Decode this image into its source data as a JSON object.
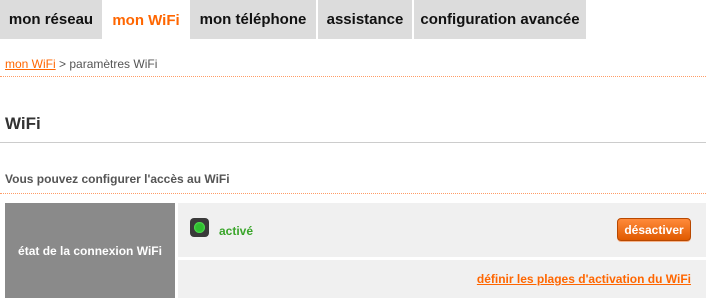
{
  "nav": {
    "tabs": [
      {
        "label": "mon réseau",
        "active": false
      },
      {
        "label": "mon WiFi",
        "active": true
      },
      {
        "label": "mon téléphone",
        "active": false
      },
      {
        "label": "assistance",
        "active": false
      },
      {
        "label": "configuration avancée",
        "active": false
      }
    ]
  },
  "breadcrumb": {
    "link": "mon WiFi",
    "separator": " > ",
    "current": "paramètres WiFi"
  },
  "page": {
    "title": "WiFi",
    "intro": "Vous pouvez configurer l'accès au WiFi"
  },
  "connection": {
    "label": "état de la connexion WiFi",
    "status_text": "activé",
    "status_icon": "status-on-icon",
    "toggle_button": "désactiver",
    "schedule_link": "définir les plages d'activation du WiFi"
  },
  "colors": {
    "accent": "#ff6600",
    "status_on": "#3aa52a",
    "label_cell_bg": "#8a8a8a",
    "row_bg": "#f0f0f0"
  }
}
